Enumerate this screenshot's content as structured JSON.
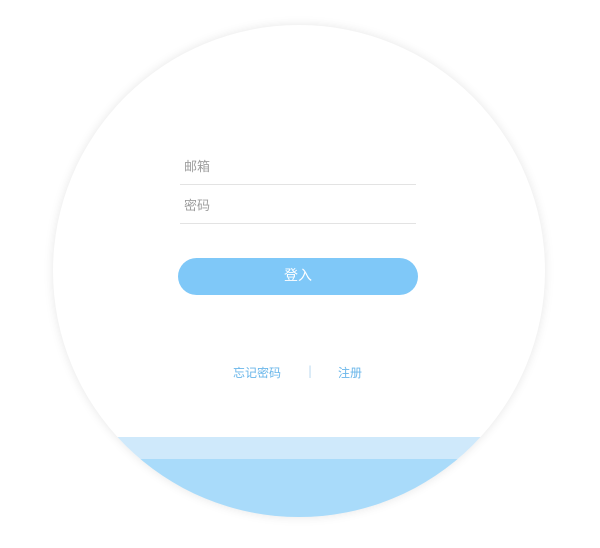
{
  "form": {
    "email_placeholder": "邮箱",
    "password_placeholder": "密码",
    "login_label": "登入"
  },
  "links": {
    "forgot_password": "忘记密码",
    "separator": "|",
    "register": "注册"
  },
  "colors": {
    "accent": "#7fc8f8",
    "link": "#69b6ea",
    "wave_light": "#cfe9fb",
    "wave_main": "#a9dbfa"
  }
}
